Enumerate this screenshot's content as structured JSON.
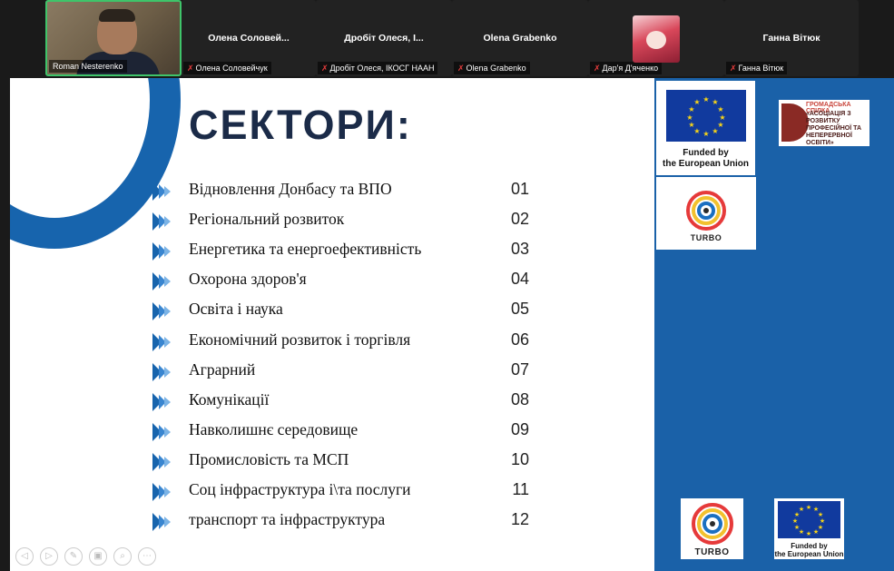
{
  "participants": {
    "active": {
      "name": "Roman Nesterenko"
    },
    "tiles": [
      {
        "big_name": "Олена  Соловей...",
        "tag": "Олена Соловейчук"
      },
      {
        "big_name": "Дробіт Олеся, І...",
        "tag": "Дробіт Олеся, ІКОСГ НААН"
      },
      {
        "big_name": "Olena Grabenko",
        "tag": "Olena Grabenko"
      },
      {
        "big_name": "",
        "tag": "Дар'я Д'яченко"
      },
      {
        "big_name": "Ганна Вітюк",
        "tag": "Ганна Вітюк"
      }
    ]
  },
  "slide": {
    "title": "СЕКТОРИ:",
    "sectors": [
      {
        "label": "Відновлення Донбасу та ВПО",
        "num": "01"
      },
      {
        "label": "Регіональний розвиток",
        "num": "02"
      },
      {
        "label": "Енергетика та енергоефективність",
        "num": "03"
      },
      {
        "label": "Охорона здоров'я",
        "num": "04"
      },
      {
        "label": "Освіта і наука",
        "num": "05"
      },
      {
        "label": "Економічний розвиток і торгівля",
        "num": "06"
      },
      {
        "label": "Аграрний",
        "num": "07"
      },
      {
        "label": "Комунікації",
        "num": "08"
      },
      {
        "label": "Навколишнє середовище",
        "num": "09"
      },
      {
        "label": "Промисловість та МСП",
        "num": "10"
      },
      {
        "label": "Соц інфраструктура і\\та послуги",
        "num": "11"
      },
      {
        "label": "транспорт та інфраструктура",
        "num": "12"
      }
    ]
  },
  "panel": {
    "eu_top": {
      "line1": "Funded by",
      "line2": "the European Union"
    },
    "association": {
      "line1": "ГРОМАДСЬКА СПІЛКА",
      "line2": "«АСОЦІАЦІЯ З РОЗВИТКУ ПРОФЕСІЙНОЇ ТА НЕПЕРЕРВНОЇ ОСВІТИ»"
    },
    "turbo_top": "TURBO",
    "turbo_bottom": "TURBO",
    "eu_bottom": {
      "line1": "Funded by",
      "line2": "the European Union"
    }
  },
  "colors": {
    "accent_blue": "#1764ad",
    "title_navy": "#1b2b48",
    "panel_blue": "#1a61a8",
    "active_border": "#3fc46a"
  },
  "icons": [
    "mic-muted-icon",
    "play-arrows-icon",
    "eu-stars-icon",
    "turbo-spiral-icon"
  ]
}
